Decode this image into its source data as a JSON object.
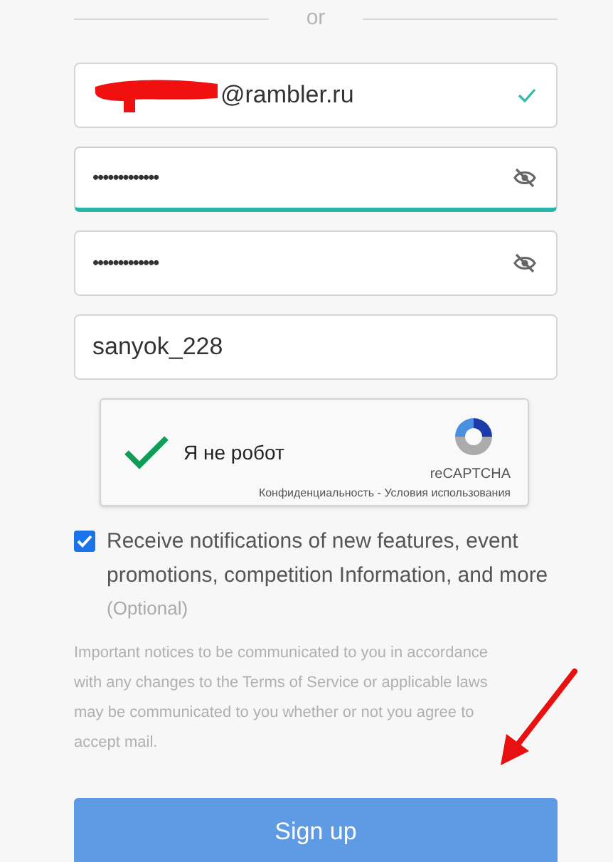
{
  "divider": {
    "label": "or"
  },
  "fields": [
    {
      "kind": "email",
      "value": "@rambler.ru",
      "valid": true,
      "focused": false
    },
    {
      "kind": "password",
      "value": "•••••••••••••",
      "focused": true
    },
    {
      "kind": "password",
      "value": "•••••••••••••",
      "focused": false
    },
    {
      "kind": "text",
      "value": "sanyok_228",
      "focused": false
    }
  ],
  "captcha": {
    "checked": true,
    "label": "Я не робот",
    "brand": "reCAPTCHA",
    "links": "Конфиденциальность - Условия использования"
  },
  "newsletter": {
    "checked": true,
    "label": "Receive notifications of new features, event promotions, competition Information, and more",
    "note": "(Optional)"
  },
  "notice": "Important notices to be communicated to you in accordance with any changes to the Terms of Service or applicable laws may be communicated to you whether or not you agree to accept mail.",
  "submit": {
    "label": "Sign up"
  }
}
